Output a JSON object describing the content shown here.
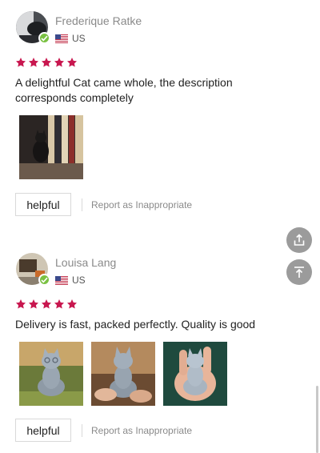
{
  "reviews": [
    {
      "name": "Frederique Ratke",
      "country": "US",
      "rating": 5,
      "text": "A delightful Cat came whole, the description corresponds completely",
      "helpful_label": "helpful",
      "report_label": "Report as Inappropriate"
    },
    {
      "name": "Louisa Lang",
      "country": "US",
      "rating": 5,
      "text": "Delivery is fast, packed perfectly. Quality is good",
      "helpful_label": "helpful",
      "report_label": "Report as Inappropriate"
    }
  ],
  "colors": {
    "star": "#c8174f",
    "verified": "#7ac142",
    "fab": "#9b9b9b"
  },
  "icons": {
    "share": "share-icon",
    "back_to_top": "back-to-top-icon"
  }
}
